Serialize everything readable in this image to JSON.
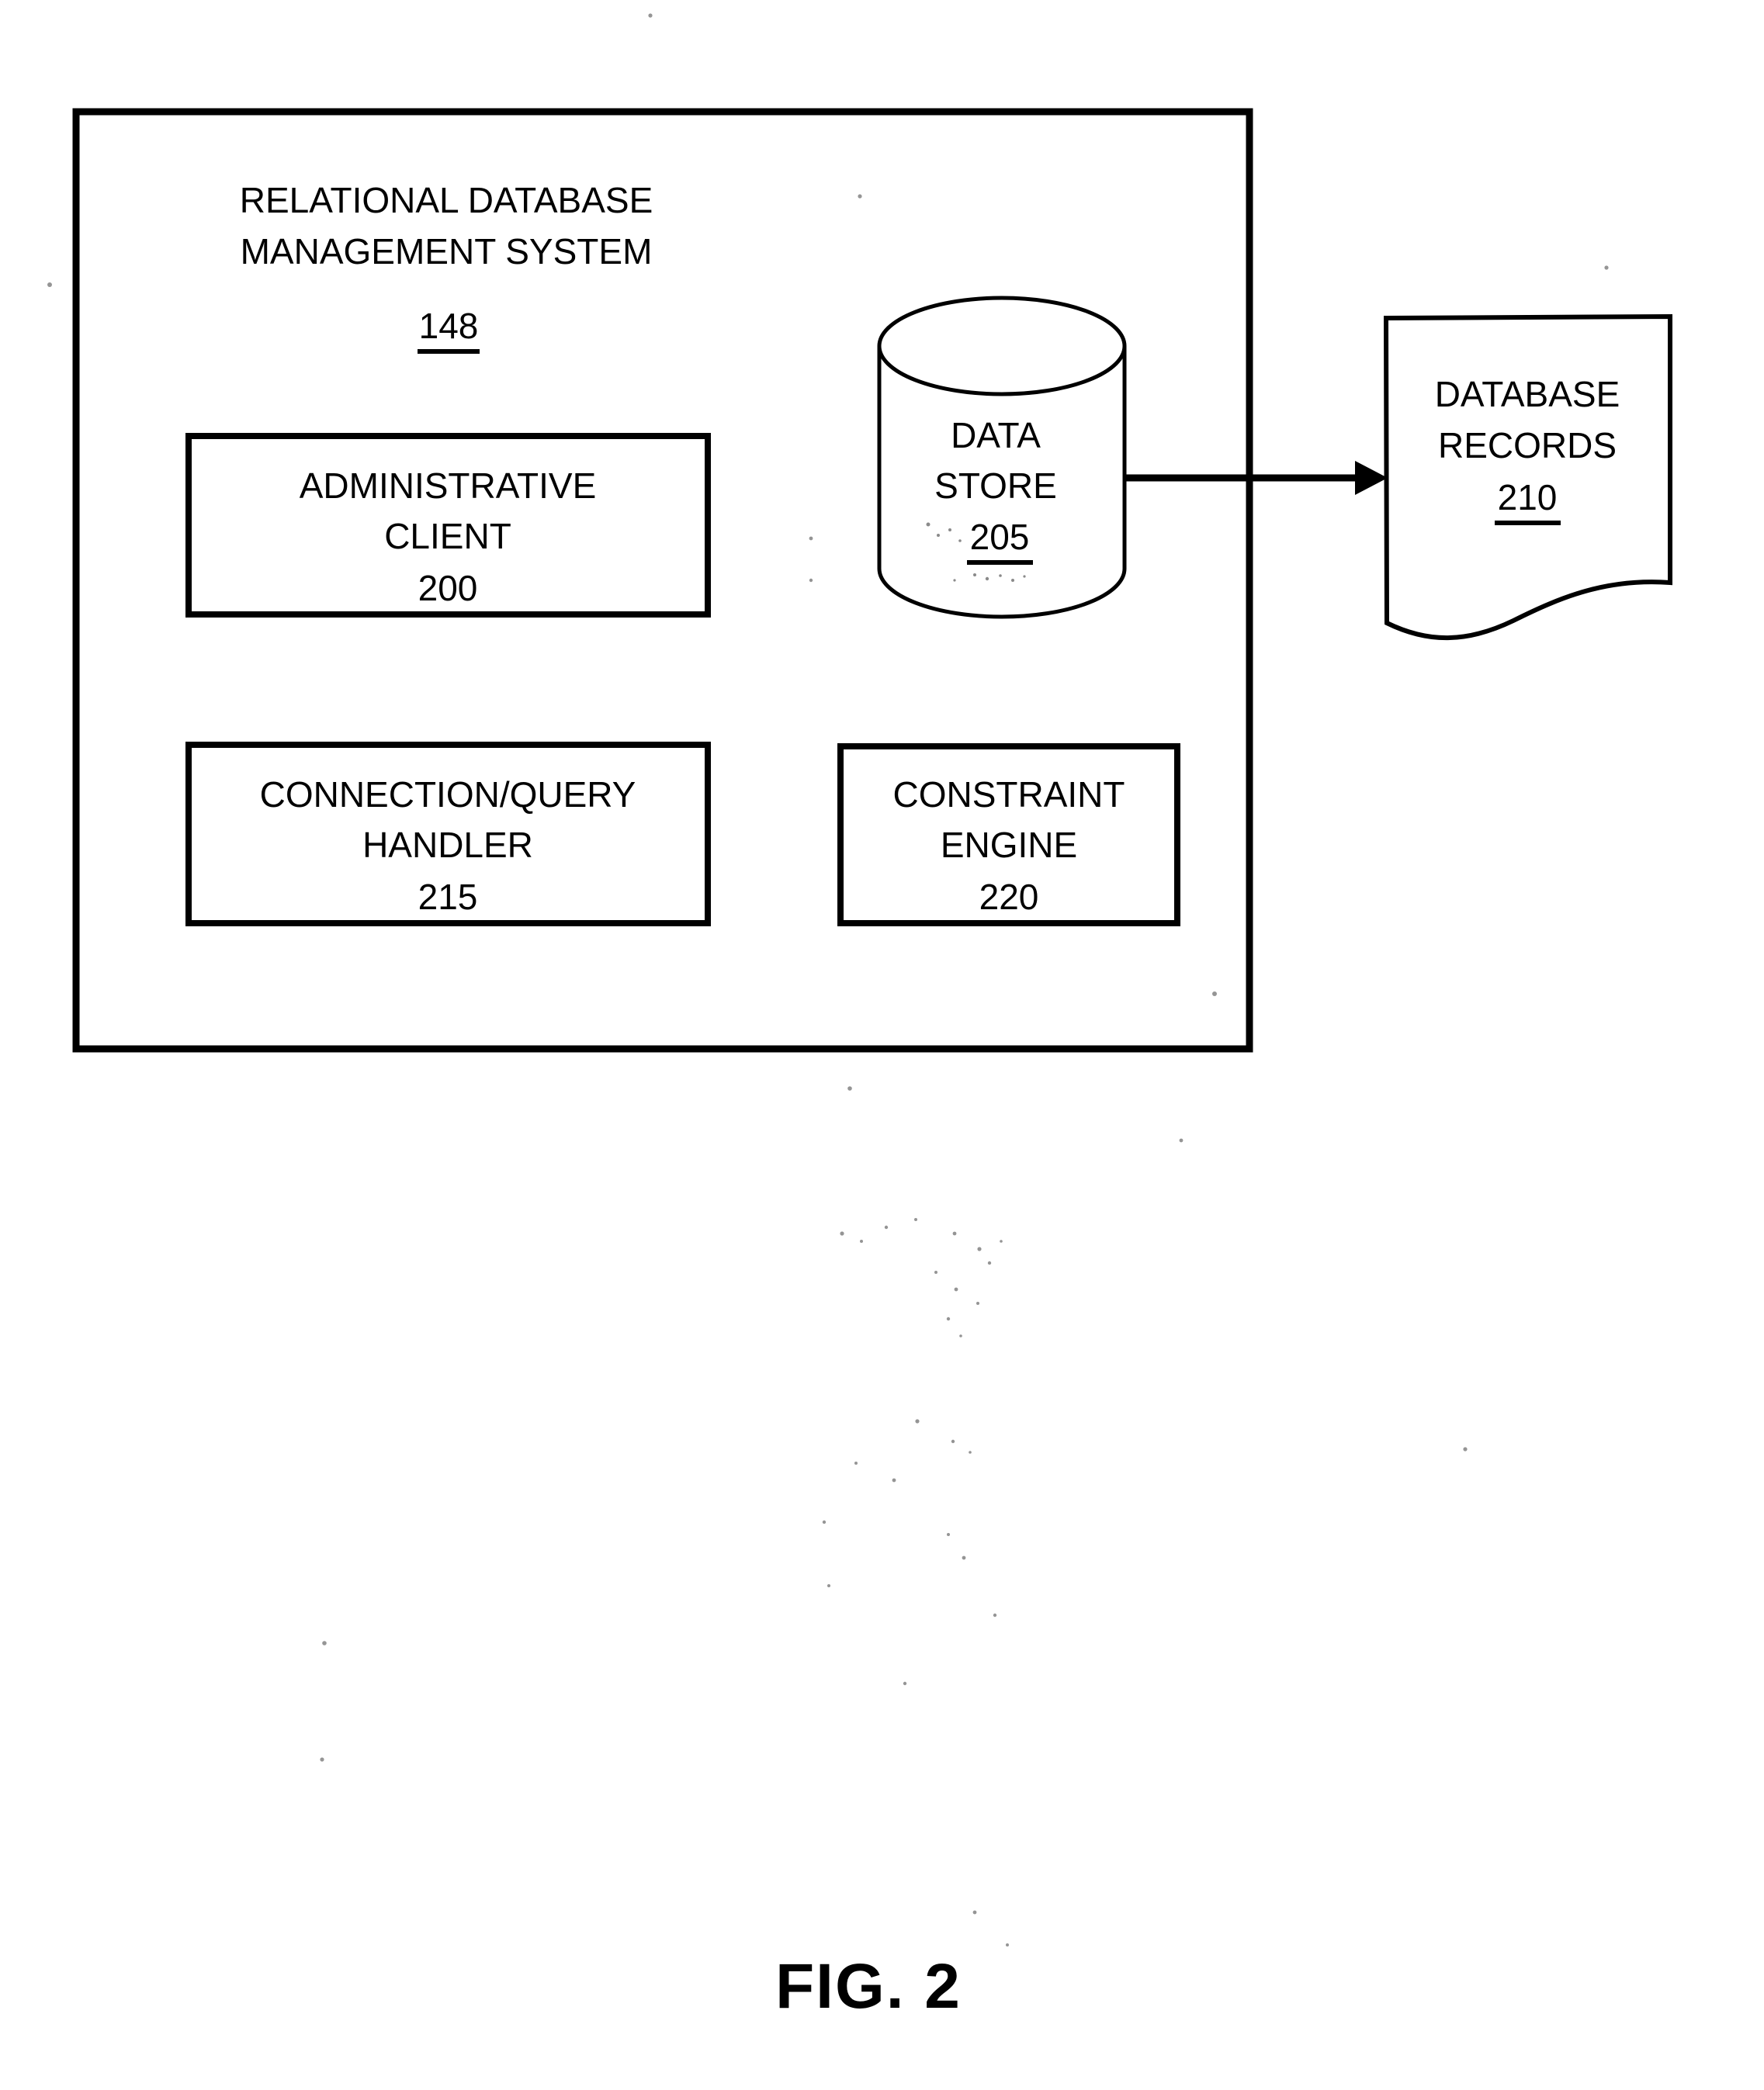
{
  "figure": {
    "caption": "FIG. 2"
  },
  "system_box": {
    "title_line1": "RELATIONAL DATABASE",
    "title_line2": "MANAGEMENT SYSTEM",
    "reference_numeral": "148"
  },
  "components": [
    {
      "id": "administrative-client",
      "label_line1": "ADMINISTRATIVE",
      "label_line2": "CLIENT",
      "reference_numeral": "200",
      "shape": "rectangle"
    },
    {
      "id": "connection-query-handler",
      "label_line1": "CONNECTION/QUERY",
      "label_line2": "HANDLER",
      "reference_numeral": "215",
      "shape": "rectangle"
    },
    {
      "id": "constraint-engine",
      "label_line1": "CONSTRAINT",
      "label_line2": "ENGINE",
      "reference_numeral": "220",
      "shape": "rectangle"
    },
    {
      "id": "data-store",
      "label_line1": "DATA",
      "label_line2": "STORE",
      "reference_numeral": "205",
      "shape": "cylinder"
    },
    {
      "id": "database-records",
      "label_line1": "DATABASE",
      "label_line2": "RECORDS",
      "reference_numeral": "210",
      "shape": "document"
    }
  ],
  "connections": [
    {
      "id": "data-store-to-database-records",
      "from": "data-store",
      "to": "database-records",
      "style": "solid-arrow",
      "direction": "right"
    }
  ],
  "colors": {
    "stroke": "#000000",
    "background": "#ffffff",
    "text": "#000000"
  }
}
